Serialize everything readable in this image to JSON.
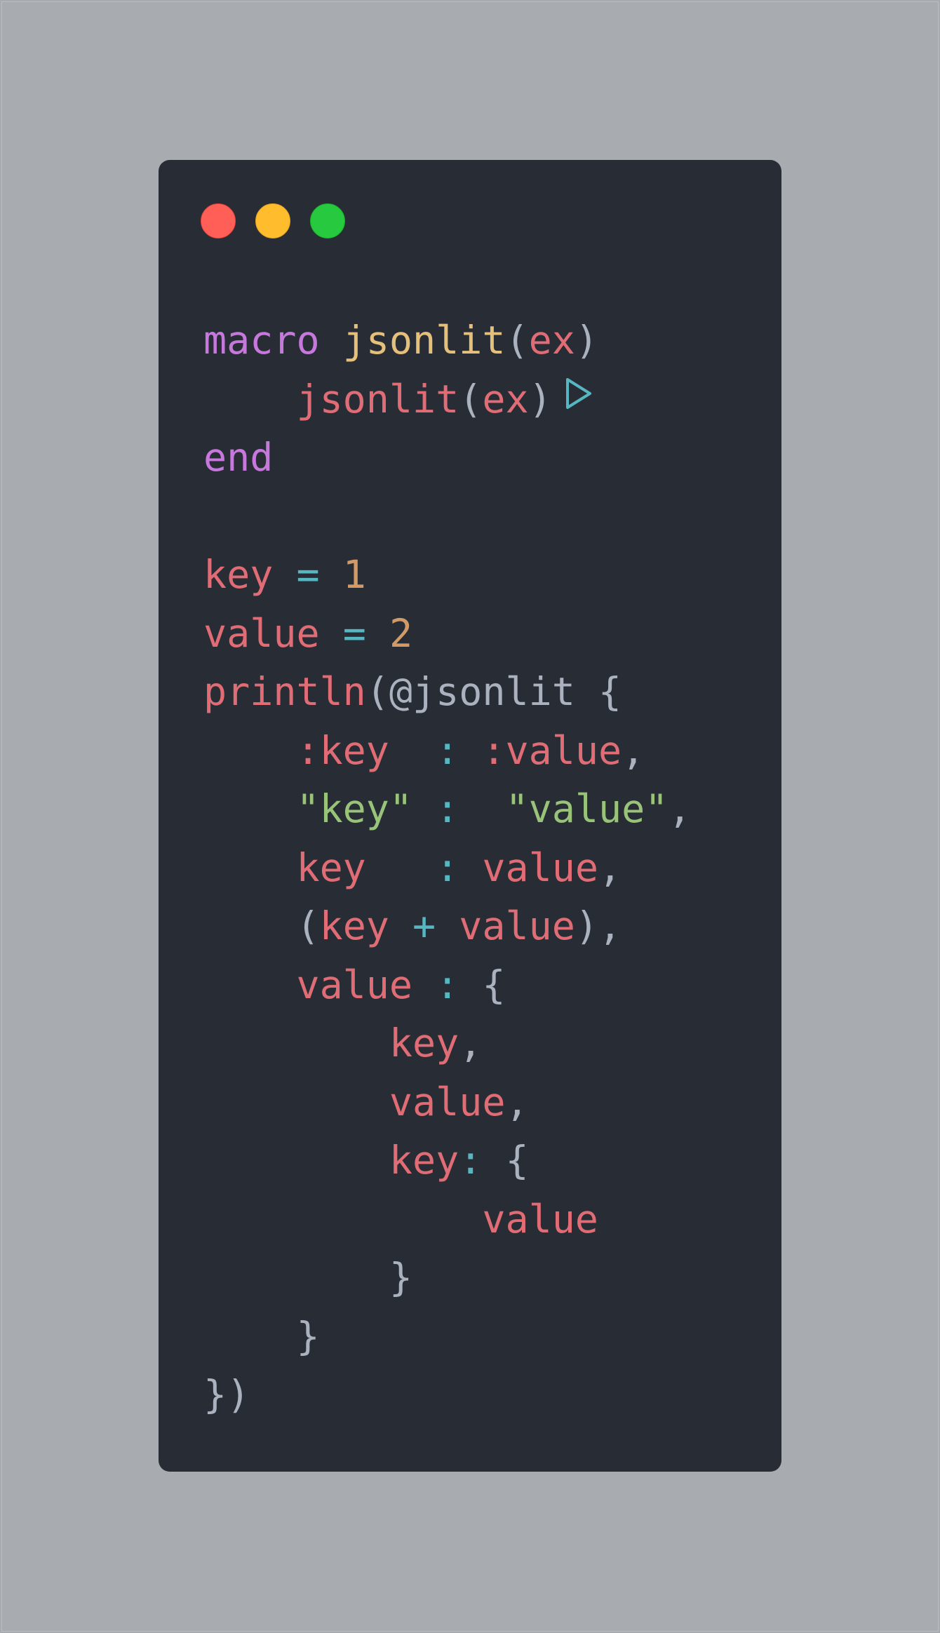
{
  "window": {
    "controls": [
      "close",
      "minimize",
      "maximize"
    ],
    "colors": {
      "close": "#ff5f56",
      "minimize": "#ffbd2e",
      "maximize": "#27c93f",
      "background": "#282c34"
    }
  },
  "code": {
    "language": "julia",
    "lines": [
      {
        "tokens": [
          {
            "t": "macro",
            "c": "kw"
          },
          {
            "t": " ",
            "c": "punc"
          },
          {
            "t": "jsonlit",
            "c": "fn"
          },
          {
            "t": "(",
            "c": "punc"
          },
          {
            "t": "ex",
            "c": "var"
          },
          {
            "t": ")",
            "c": "punc"
          }
        ]
      },
      {
        "tokens": [
          {
            "t": "    ",
            "c": "punc"
          },
          {
            "t": "jsonlit",
            "c": "var"
          },
          {
            "t": "(",
            "c": "punc"
          },
          {
            "t": "ex",
            "c": "var"
          },
          {
            "t": ")",
            "c": "punc"
          }
        ],
        "run_icon": true
      },
      {
        "tokens": [
          {
            "t": "end",
            "c": "kw"
          }
        ]
      },
      {
        "tokens": []
      },
      {
        "tokens": [
          {
            "t": "key",
            "c": "var"
          },
          {
            "t": " ",
            "c": "punc"
          },
          {
            "t": "=",
            "c": "op"
          },
          {
            "t": " ",
            "c": "punc"
          },
          {
            "t": "1",
            "c": "num"
          }
        ]
      },
      {
        "tokens": [
          {
            "t": "value",
            "c": "var"
          },
          {
            "t": " ",
            "c": "punc"
          },
          {
            "t": "=",
            "c": "op"
          },
          {
            "t": " ",
            "c": "punc"
          },
          {
            "t": "2",
            "c": "num"
          }
        ]
      },
      {
        "tokens": [
          {
            "t": "println",
            "c": "var"
          },
          {
            "t": "(@jsonlit {",
            "c": "punc"
          }
        ]
      },
      {
        "tokens": [
          {
            "t": "    ",
            "c": "punc"
          },
          {
            "t": ":key",
            "c": "var"
          },
          {
            "t": "  ",
            "c": "punc"
          },
          {
            "t": ":",
            "c": "op"
          },
          {
            "t": " ",
            "c": "punc"
          },
          {
            "t": ":value",
            "c": "var"
          },
          {
            "t": ",",
            "c": "punc"
          }
        ]
      },
      {
        "tokens": [
          {
            "t": "    ",
            "c": "punc"
          },
          {
            "t": "\"key\"",
            "c": "str"
          },
          {
            "t": " ",
            "c": "punc"
          },
          {
            "t": ":",
            "c": "op"
          },
          {
            "t": "  ",
            "c": "punc"
          },
          {
            "t": "\"value\"",
            "c": "str"
          },
          {
            "t": ",",
            "c": "punc"
          }
        ]
      },
      {
        "tokens": [
          {
            "t": "    ",
            "c": "punc"
          },
          {
            "t": "key",
            "c": "var"
          },
          {
            "t": "   ",
            "c": "punc"
          },
          {
            "t": ":",
            "c": "op"
          },
          {
            "t": " ",
            "c": "punc"
          },
          {
            "t": "value",
            "c": "var"
          },
          {
            "t": ",",
            "c": "punc"
          }
        ]
      },
      {
        "tokens": [
          {
            "t": "    ",
            "c": "punc"
          },
          {
            "t": "(",
            "c": "punc"
          },
          {
            "t": "key",
            "c": "var"
          },
          {
            "t": " ",
            "c": "punc"
          },
          {
            "t": "+",
            "c": "op"
          },
          {
            "t": " ",
            "c": "punc"
          },
          {
            "t": "value",
            "c": "var"
          },
          {
            "t": "),",
            "c": "punc"
          }
        ]
      },
      {
        "tokens": [
          {
            "t": "    ",
            "c": "punc"
          },
          {
            "t": "value",
            "c": "var"
          },
          {
            "t": " ",
            "c": "punc"
          },
          {
            "t": ":",
            "c": "op"
          },
          {
            "t": " {",
            "c": "punc"
          }
        ]
      },
      {
        "tokens": [
          {
            "t": "        ",
            "c": "punc"
          },
          {
            "t": "key",
            "c": "var"
          },
          {
            "t": ",",
            "c": "punc"
          }
        ]
      },
      {
        "tokens": [
          {
            "t": "        ",
            "c": "punc"
          },
          {
            "t": "value",
            "c": "var"
          },
          {
            "t": ",",
            "c": "punc"
          }
        ]
      },
      {
        "tokens": [
          {
            "t": "        ",
            "c": "punc"
          },
          {
            "t": "key",
            "c": "var"
          },
          {
            "t": ":",
            "c": "op"
          },
          {
            "t": " {",
            "c": "punc"
          }
        ]
      },
      {
        "tokens": [
          {
            "t": "            ",
            "c": "punc"
          },
          {
            "t": "value",
            "c": "var"
          }
        ]
      },
      {
        "tokens": [
          {
            "t": "        ",
            "c": "punc"
          },
          {
            "t": "}",
            "c": "punc"
          }
        ]
      },
      {
        "tokens": [
          {
            "t": "    ",
            "c": "punc"
          },
          {
            "t": "}",
            "c": "punc"
          }
        ]
      },
      {
        "tokens": [
          {
            "t": "})",
            "c": "punc"
          }
        ]
      }
    ],
    "run_icon": "play-triangle-icon",
    "token_colors": {
      "kw": "#c678dd",
      "fn": "#e5c07b",
      "var": "#e06c75",
      "op": "#56b6c2",
      "num": "#d19a66",
      "str": "#98c379",
      "punc": "#abb2bf"
    }
  }
}
